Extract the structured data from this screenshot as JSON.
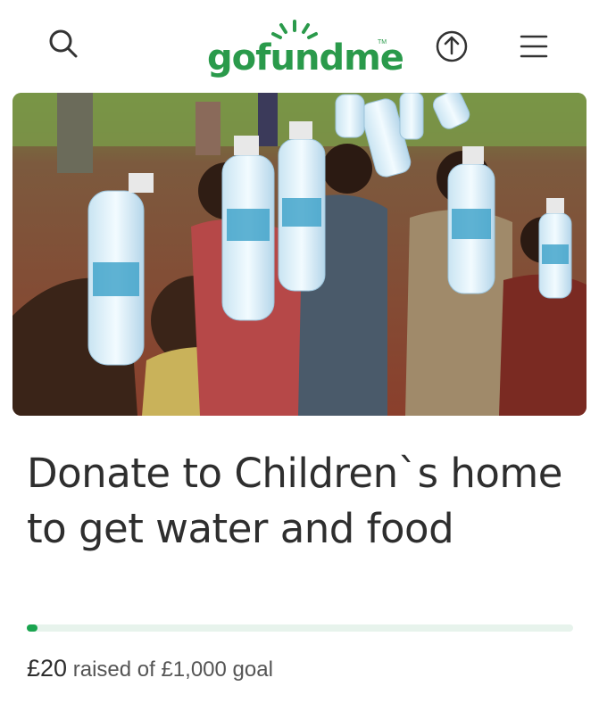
{
  "header": {
    "logo_text": "gofundme",
    "logo_tm": "TM",
    "icons": [
      "search-icon",
      "share-icon",
      "menu-icon"
    ]
  },
  "campaign": {
    "title": "Donate to Children`s home to get water and food",
    "raised_amount": "£20",
    "raised_suffix": "raised of £1,000 goal",
    "progress_fraction": 0.02
  },
  "colors": {
    "brand_green": "#2a9a4b",
    "progress_fill": "#1aa44f",
    "progress_track": "#e7f3ec"
  }
}
